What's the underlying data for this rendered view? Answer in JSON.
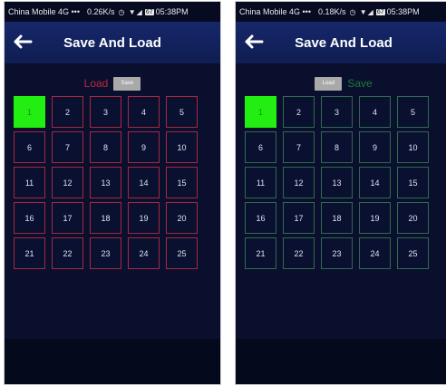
{
  "status_bar_left": {
    "carrier": "China Mobile 4G •••",
    "speed": "0.26K/s",
    "icons": "◷ ▼◢",
    "battery": "67",
    "time": "05:38PM"
  },
  "status_bar_right": {
    "carrier": "China Mobile 4G •••",
    "speed": "0.18K/s",
    "icons": "◷ ▼◢",
    "battery": "67",
    "time": "05:38PM"
  },
  "header": {
    "title": "Save And Load"
  },
  "left_screen": {
    "active_mode": "Load",
    "inactive_mode": "Save",
    "active_color": "#c0283c",
    "slot_border_color": "#a4283f"
  },
  "right_screen": {
    "active_mode": "Save",
    "inactive_mode": "Load",
    "active_color": "#1f7a3a",
    "slot_border_color": "#2f6b4c"
  },
  "selected_slot": "1",
  "selected_color": "#22ee11",
  "slots": [
    "1",
    "2",
    "3",
    "4",
    "5",
    "6",
    "7",
    "8",
    "9",
    "10",
    "11",
    "12",
    "13",
    "14",
    "15",
    "16",
    "17",
    "18",
    "19",
    "20",
    "21",
    "22",
    "23",
    "24",
    "25"
  ]
}
